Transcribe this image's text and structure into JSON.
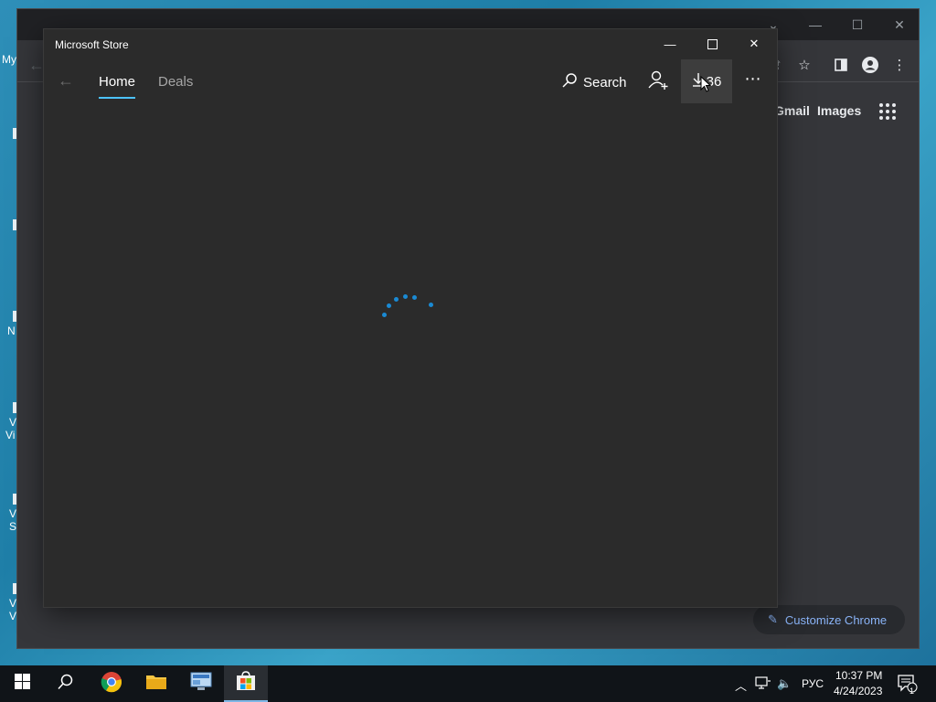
{
  "desktop": {
    "fragments": [
      "My",
      "N",
      "V",
      "Vi",
      "V",
      "S",
      "V",
      "V"
    ]
  },
  "chrome": {
    "links": {
      "gmail": "Gmail",
      "images": "Images"
    },
    "customize_label": "Customize Chrome"
  },
  "store": {
    "title": "Microsoft Store",
    "tabs": [
      {
        "label": "Home",
        "active": true
      },
      {
        "label": "Deals",
        "active": false
      }
    ],
    "search_label": "Search",
    "downloads_count": "36",
    "more_label": "⋯",
    "status": "loading"
  },
  "taskbar": {
    "apps": [
      {
        "name": "start",
        "icon": "windows-logo-icon"
      },
      {
        "name": "search",
        "icon": "search-icon"
      },
      {
        "name": "chrome",
        "icon": "chrome-icon"
      },
      {
        "name": "file-explorer",
        "icon": "folder-icon"
      },
      {
        "name": "control-panel",
        "icon": "monitor-icon"
      },
      {
        "name": "microsoft-store",
        "icon": "store-bag-icon",
        "active": true
      }
    ],
    "tray": {
      "language": "РУС",
      "time": "10:37 PM",
      "date": "4/24/2023",
      "notification_count": "1"
    }
  },
  "colors": {
    "store_bg": "#2b2b2b",
    "accent": "#4cc2ff",
    "spinner": "#1a8ad4",
    "chrome_link": "#8ab4f8",
    "taskbar": "#101418"
  }
}
